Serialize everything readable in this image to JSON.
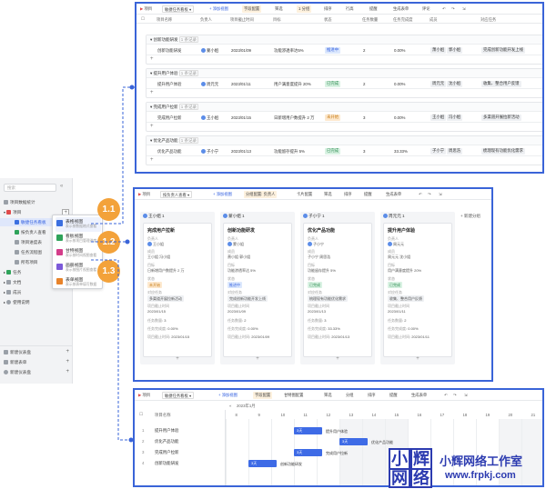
{
  "sidebar": {
    "search_placeholder": "搜索",
    "items": [
      {
        "label": "项目数据统计"
      },
      {
        "label": "项目"
      },
      {
        "label": "敏捷任务看板"
      },
      {
        "label": "按负责人查看"
      },
      {
        "label": "项目进度表"
      },
      {
        "label": "任务流程图"
      },
      {
        "label": "所有项目"
      },
      {
        "label": "任务"
      },
      {
        "label": "文档"
      },
      {
        "label": "成员"
      },
      {
        "label": "使用说明"
      },
      {
        "label": "新建仪表盘"
      },
      {
        "label": "新建表单"
      },
      {
        "label": "新建仪表盘"
      }
    ]
  },
  "view_menu": {
    "items": [
      {
        "title": "表格视图",
        "desc": "表示按数据格式查看",
        "color": "#3b6fe0"
      },
      {
        "title": "看板视图",
        "desc": "表示按项目管理进度",
        "color": "#2fa35a"
      },
      {
        "title": "甘特视图",
        "desc": "表示按时间视图查看",
        "color": "#d43d8a"
      },
      {
        "title": "画册视图",
        "desc": "表示按图片视图查看",
        "color": "#7c5ad9"
      },
      {
        "title": "表单视图",
        "desc": "表示按表单填写数据",
        "color": "#e8832a"
      }
    ]
  },
  "badges": [
    "1.1",
    "1.2",
    "1.3"
  ],
  "table_panel": {
    "toolbar": [
      "项目",
      "敏捷任务看板",
      "+ 添加视图",
      "字段配置",
      "筛选",
      "1 分组",
      "排序",
      "行高",
      "提醒",
      "生成表单",
      "评论"
    ],
    "columns": [
      "项目名称",
      "负责人",
      "项目截止时间",
      "目标",
      "状态",
      "任务数量",
      "任务完成度",
      "成员",
      "对应任务"
    ],
    "groups": [
      {
        "name": "创新功能研发",
        "count": "1 条记录",
        "row": [
          "创新功能研发",
          "蒙小姐",
          "2023/01/09",
          "功能渗透率达5%",
          "推进中",
          "2",
          "0.00%",
          "萧小姐",
          "郭小姐",
          "完成创新功能开发上线"
        ]
      },
      {
        "name": "提升用户体验",
        "count": "1 条记录",
        "row": [
          "提升用户体验",
          "周元元",
          "2023/01/11",
          "用户满意度提升 20%",
          "已完成",
          "2",
          "0.00%",
          "周元元",
          "沈小姐",
          "收集、整合用户反馈"
        ]
      },
      {
        "name": "完成用户拉新",
        "count": "1 条记录",
        "row": [
          "完成用户拉新",
          "王小姐",
          "2023/01/15",
          "日新增用户数提升 2 万",
          "未开始",
          "3",
          "0.00%",
          "王小姐",
          "冯小姐",
          "多渠道开展拉新活动"
        ]
      },
      {
        "name": "优化产品功能",
        "count": "1 条记录",
        "row": [
          "优化产品功能",
          "子小宁",
          "2023/01/13",
          "功能留存提升 5%",
          "已完成",
          "3",
          "33.33%",
          "子小宁",
          "周思浩",
          "梳理现有功能优化需求"
        ]
      }
    ]
  },
  "kanban_panel": {
    "toolbar": [
      "项目",
      "按负责人查看",
      "+ 添加视图",
      "分组配置: 负责人",
      "卡片配置",
      "筛选",
      "排序",
      "提醒",
      "生成表单"
    ],
    "columns": [
      {
        "head": "王小姐 1",
        "title": "完成用户拉新",
        "owner": "王小姐",
        "members": "王小姐  冯小姐",
        "goal": "日新增用户数提升 2 万",
        "status": "未开始",
        "task": "多渠道开展拉新活动",
        "date": "2023/01/15",
        "count": "3",
        "done": "0.00%"
      },
      {
        "head": "蒙小姐 1",
        "title": "创新功能研发",
        "owner": "蒙小姐",
        "members": "萧小姐  郭小姐",
        "goal": "功能渗透率达 5%",
        "status": "推进中",
        "task": "完成创新功能开发上线",
        "date": "2023/01/09",
        "count": "2",
        "done": "0.00%"
      },
      {
        "head": "子小宁 1",
        "title": "优化产品功能",
        "owner": "子小宁",
        "members": "子小宁  周思浩",
        "goal": "功能留存提升 5%",
        "status": "已完成",
        "task": "梳理现有功能优化需求",
        "date": "2023/01/13",
        "count": "3",
        "done": "33.33%"
      },
      {
        "head": "周元元 1",
        "title": "提升用户体验",
        "owner": "周元元",
        "members": "周元元  沈小姐",
        "goal": "用户满意度提升 20%",
        "status": "已完成",
        "task": "收集、整合用户反馈",
        "date": "2023/01/11",
        "count": "2",
        "done": "0.00%"
      }
    ],
    "new_group": "+ 新建分组",
    "field_labels": {
      "owner": "负责人",
      "members": "成员",
      "goal": "目标",
      "status": "状态",
      "task": "对应任务",
      "date": "项目截止时间",
      "count": "任务数量",
      "done": "任务完成度"
    }
  },
  "gantt_panel": {
    "toolbar": [
      "项目",
      "敏捷任务看板",
      "+ 添加视图",
      "字段配置",
      "甘特图配置",
      "筛选",
      "分组",
      "排序",
      "提醒",
      "生成表单"
    ],
    "month": "2023年1月",
    "header_col": "项目名称",
    "days": [
      "8",
      "9",
      "10",
      "11",
      "12",
      "13",
      "14",
      "15",
      "16",
      "17",
      "18",
      "19",
      "20",
      "21"
    ],
    "rows": [
      {
        "no": "1",
        "name": "提升用户体验",
        "bar": "3天",
        "label": "提升用户体验",
        "start": 3,
        "len": 1
      },
      {
        "no": "2",
        "name": "优化产品功能",
        "bar": "3天",
        "label": "优化产品功能",
        "start": 5,
        "len": 1
      },
      {
        "no": "3",
        "name": "完成用户拉新",
        "bar": "3天",
        "label": "完成用户拉新",
        "start": 3,
        "len": 1
      },
      {
        "no": "4",
        "name": "创新功能研发",
        "bar": "3天",
        "label": "创新功能研发",
        "start": 1,
        "len": 1
      }
    ]
  },
  "watermark": {
    "chars": [
      "小",
      "辉",
      "网",
      "络"
    ],
    "title": "小辉网络工作室",
    "url": "www.frpkj.com"
  }
}
